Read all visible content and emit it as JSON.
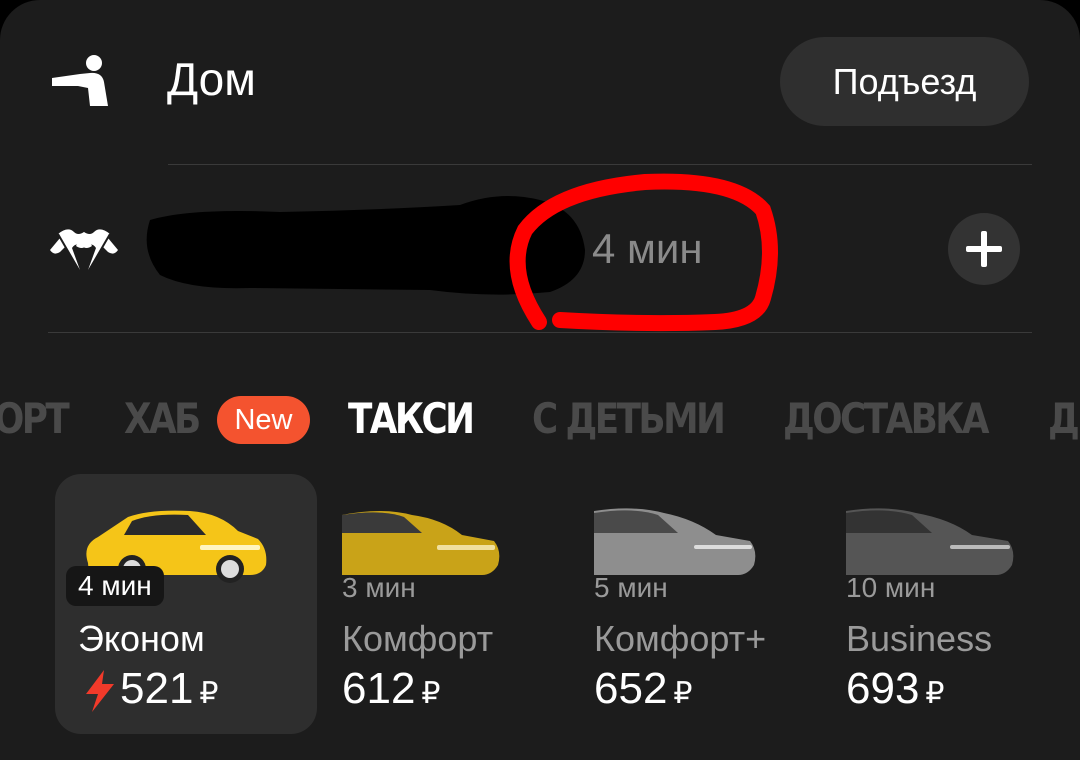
{
  "route": {
    "from_label": "Дом",
    "entrance_button": "Подъезд",
    "to_eta": "4 мин",
    "add_stop_symbol": "+"
  },
  "tabs": [
    {
      "label": "ОРТ",
      "active": false
    },
    {
      "label": "ХАБ",
      "active": false
    },
    {
      "label": "ТАКСИ",
      "active": true
    },
    {
      "label": "С ДЕТЬМИ",
      "active": false
    },
    {
      "label": "ДОСТАВКА",
      "active": false
    },
    {
      "label": "Д",
      "active": false
    }
  ],
  "new_badge": "New",
  "tariffs": [
    {
      "eta": "4 мин",
      "name": "Эконом",
      "price": "521",
      "currency": "₽",
      "selected": true,
      "surge": true
    },
    {
      "eta": "3 мин",
      "name": "Комфорт",
      "price": "612",
      "currency": "₽",
      "selected": false,
      "surge": false
    },
    {
      "eta": "5 мин",
      "name": "Комфорт+",
      "price": "652",
      "currency": "₽",
      "selected": false,
      "surge": false
    },
    {
      "eta": "10 мин",
      "name": "Business",
      "price": "693",
      "currency": "₽",
      "selected": false,
      "surge": false
    }
  ],
  "colors": {
    "background": "#1c1c1c",
    "badge": "#f4532f",
    "surge_bolt": "#f23a2a",
    "annotation": "#ff0000"
  }
}
